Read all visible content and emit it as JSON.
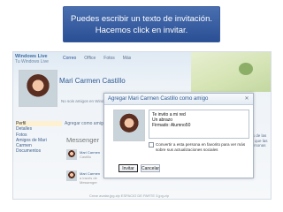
{
  "caption": {
    "line1": "Puedes escribir un texto de invitación.",
    "line2": "Hacemos click en invitar."
  },
  "profile": {
    "logo_line1": "Windows Live",
    "logo_line2": "Tu Windows Live",
    "top_nav": [
      "Correo",
      "Office",
      "Fotos",
      "Más"
    ],
    "name": "Mari Carmen Castillo",
    "friends_line": "No sois amigos en Windows Live",
    "sidebar": [
      "Perfil",
      "Detalles",
      "Fotos",
      "Amigos de Mari Carmen",
      "Documentos"
    ],
    "tabs_line": "Agregar como amigo",
    "messenger_title": "Messenger",
    "feed": [
      {
        "name": "Mari Carmen",
        "detail": "Castillo"
      },
      {
        "name": "Mari Carmen",
        "detail": "a través de Messenger"
      }
    ],
    "bottom_links": "Crear avatar.jpg.zip   ESPACIO DE PARTE 3.jpg.zip",
    "right_col": [
      "tos de las",
      "es que las",
      "personas"
    ]
  },
  "dialog": {
    "title": "Agregar Mari Carmen Castillo como amigo",
    "close_icon": "close-icon",
    "message_lines": [
      "Te invito a mi red",
      "Un abrazo",
      "Firmado: Alumno50"
    ],
    "checkbox_label": "Convertir a esta persona en favorito  para ver más sobre sus actualizaciones sociales",
    "invite_label": "Invitar",
    "cancel_label": "Cancelar"
  },
  "colors": {
    "caption_bg": "#3a5fa3",
    "link_blue": "#2f5a93"
  }
}
